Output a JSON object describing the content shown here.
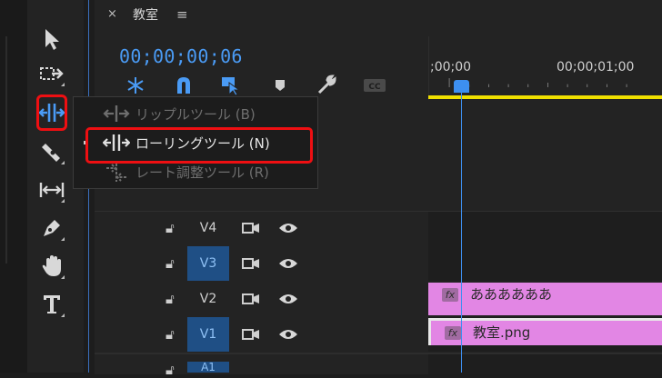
{
  "sequence_tab": {
    "close_glyph": "×",
    "title": "教室",
    "menu_glyph": "≡"
  },
  "timecode": "00;00;00;06",
  "ruler": {
    "labels": [
      ";00;00",
      "00;00;01;00"
    ]
  },
  "tools": [
    "selection-tool",
    "track-select-tool",
    "ripple-edit-tool",
    "razor-tool",
    "slip-tool",
    "pen-tool",
    "hand-tool",
    "type-tool"
  ],
  "popup_menu": {
    "items": [
      {
        "label": "リップルツール (B)",
        "state": "disabled"
      },
      {
        "label": "ローリングツール (N)",
        "state": "active"
      },
      {
        "label": "レート調整ツール (R)",
        "state": "disabled"
      }
    ]
  },
  "tracks": [
    {
      "name": "V4",
      "targeted": false
    },
    {
      "name": "V3",
      "targeted": true
    },
    {
      "name": "V2",
      "targeted": false
    },
    {
      "name": "V1",
      "targeted": true
    },
    {
      "name": "A1",
      "targeted": true
    }
  ],
  "clips": [
    {
      "track": "V2",
      "fx": "fx",
      "name": "ああああああ"
    },
    {
      "track": "V1",
      "fx": "fx",
      "name": "教室.png"
    }
  ],
  "colors": {
    "accent_blue": "#3d8ff0",
    "clip_pink": "#e286e4",
    "annotation_red": "#ee0f12",
    "work_area_yellow": "#f0e000"
  }
}
